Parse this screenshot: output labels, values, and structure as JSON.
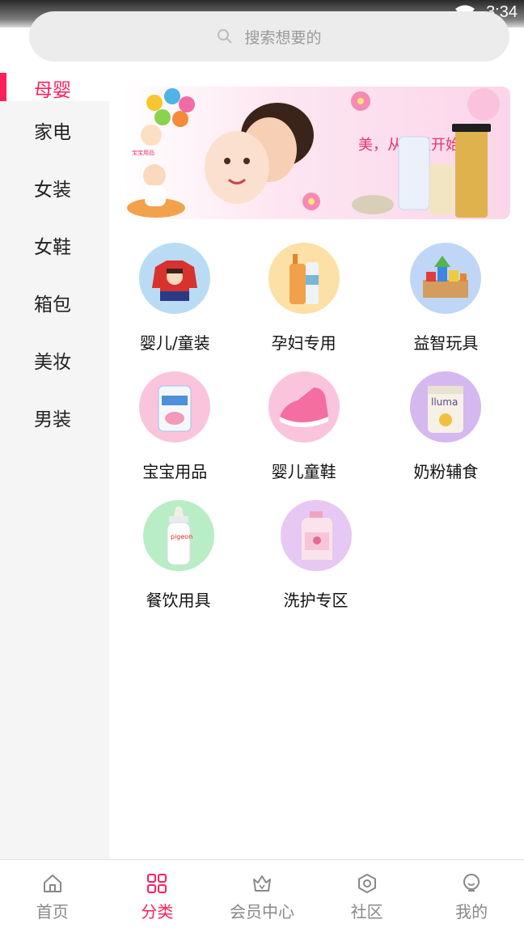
{
  "status_bar": {
    "time": "3:34"
  },
  "search": {
    "placeholder": "搜索想要的"
  },
  "sidebar": {
    "items": [
      {
        "label": "母婴",
        "active": true
      },
      {
        "label": "家电"
      },
      {
        "label": "女装"
      },
      {
        "label": "女鞋"
      },
      {
        "label": "箱包"
      },
      {
        "label": "美妆"
      },
      {
        "label": "男装"
      }
    ]
  },
  "banner": {
    "headline": "美，从这里开始 . . ."
  },
  "categories": [
    {
      "label": "婴儿/童装",
      "icon": "kids-sweater-icon"
    },
    {
      "label": "孕妇专用",
      "icon": "maternity-lotion-icon"
    },
    {
      "label": "益智玩具",
      "icon": "building-blocks-icon"
    },
    {
      "label": "宝宝用品",
      "icon": "diaper-pack-icon"
    },
    {
      "label": "婴儿童鞋",
      "icon": "baby-shoe-icon"
    },
    {
      "label": "奶粉辅食",
      "icon": "milk-powder-can-icon"
    },
    {
      "label": "餐饮用具",
      "icon": "baby-bottle-icon"
    },
    {
      "label": "洗护专区",
      "icon": "detergent-bottle-icon"
    }
  ],
  "bottom_nav": {
    "items": [
      {
        "label": "首页",
        "icon": "home-icon"
      },
      {
        "label": "分类",
        "icon": "grid-icon",
        "active": true
      },
      {
        "label": "会员中心",
        "icon": "crown-icon"
      },
      {
        "label": "社区",
        "icon": "hexagon-icon"
      },
      {
        "label": "我的",
        "icon": "profile-icon"
      }
    ]
  },
  "colors": {
    "accent": "#ff1f5a",
    "sidebar_bg": "#f5f5f5",
    "search_bg": "#ececec"
  }
}
